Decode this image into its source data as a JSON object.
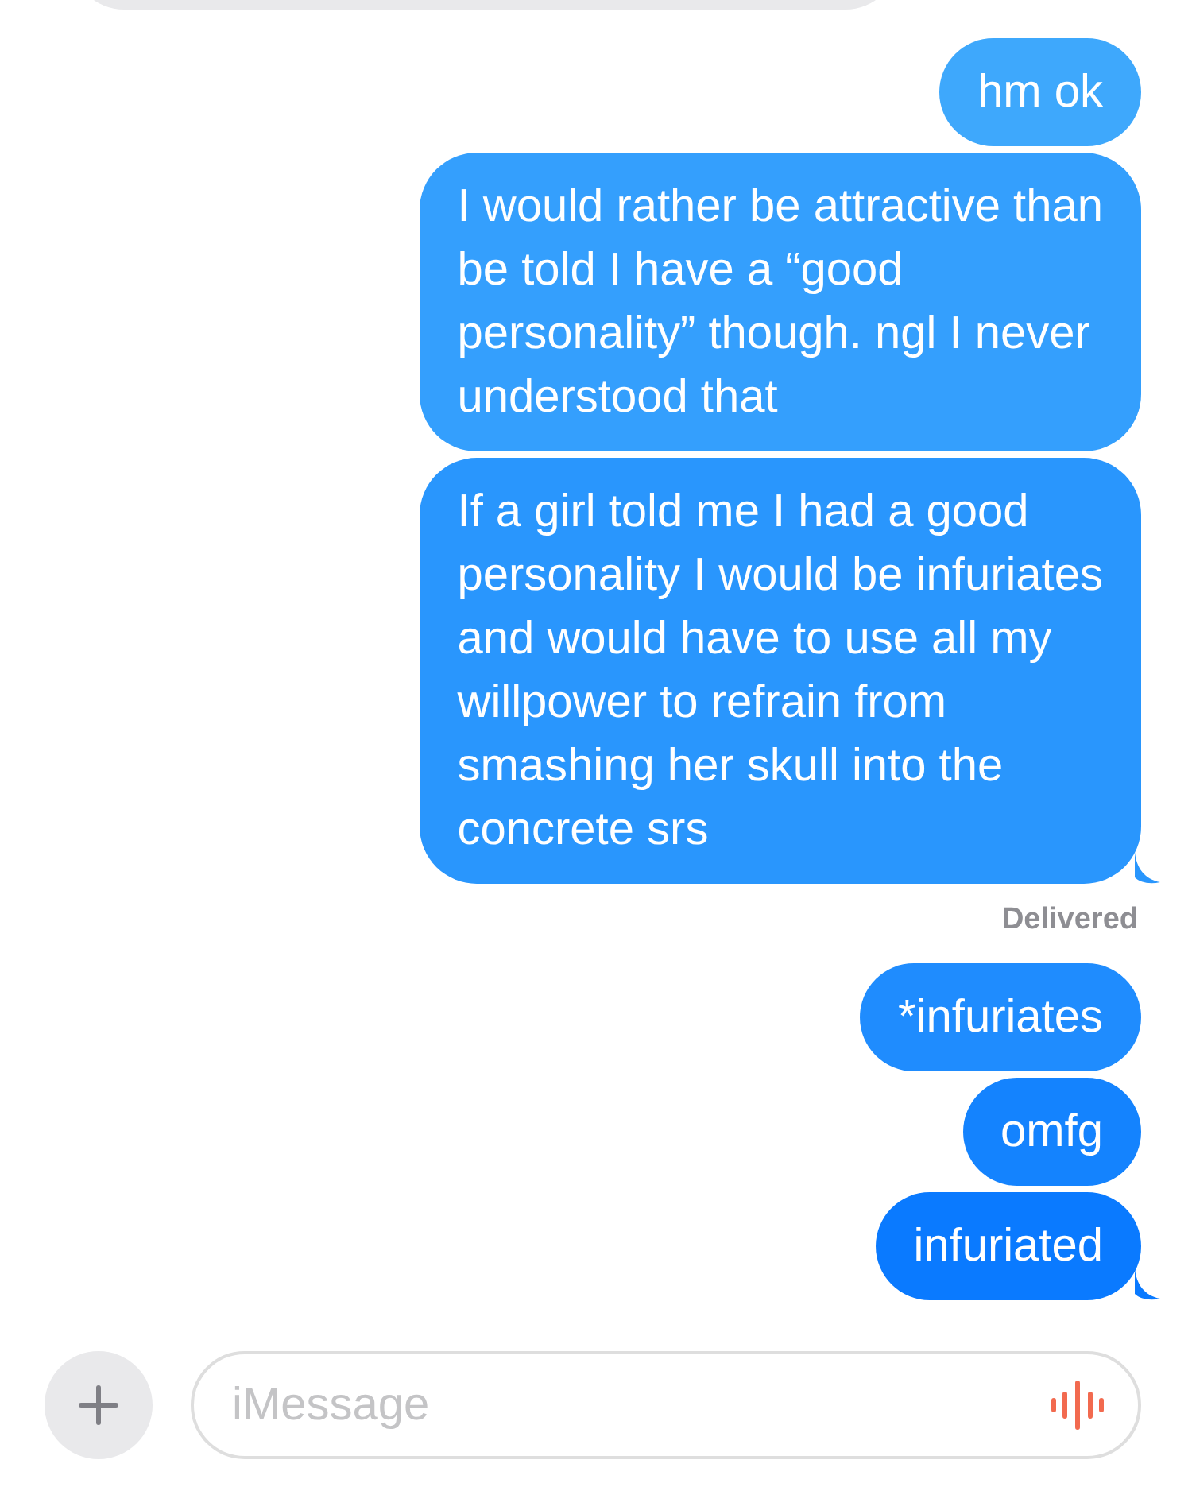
{
  "messages": [
    {
      "text": "hm ok",
      "tail": false
    },
    {
      "text": "I would rather be attractive than\nbe told I have a “good\npersonality” though. ngl I never\nunderstood that",
      "tail": false
    },
    {
      "text": "If a girl told me I had a good\npersonality I would be infuriates\nand would have to use all my\nwillpower to refrain from\nsmashing her skull into the\nconcrete srs",
      "tail": true,
      "status": "Delivered"
    },
    {
      "text": "*infuriates",
      "tail": false
    },
    {
      "text": "omfg",
      "tail": false
    },
    {
      "text": "infuriated",
      "tail": true
    }
  ],
  "composer": {
    "placeholder": "iMessage"
  }
}
